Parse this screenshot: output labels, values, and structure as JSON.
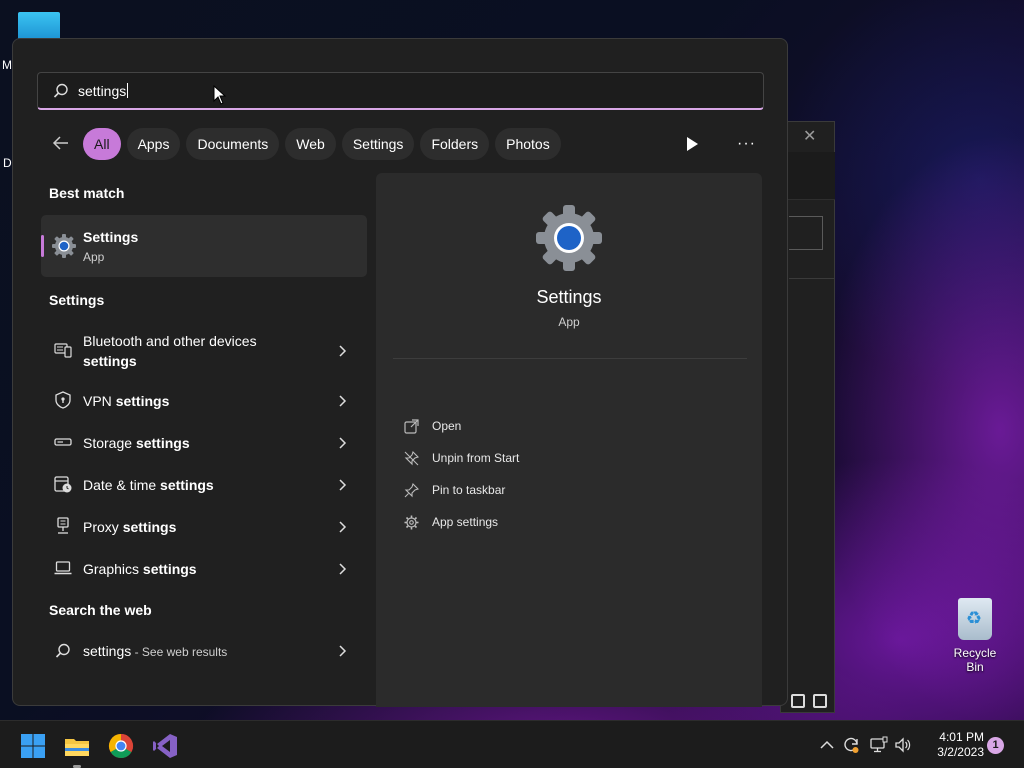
{
  "desktop": {
    "fragments": [
      "M",
      "D"
    ],
    "recycle_bin_label": "Recycle Bin"
  },
  "search": {
    "query": "settings"
  },
  "filters": {
    "chips": [
      "All",
      "Apps",
      "Documents",
      "Web",
      "Settings",
      "Folders",
      "Photos"
    ],
    "active": "All"
  },
  "left": {
    "best_match_heading": "Best match",
    "best_match": {
      "title": "Settings",
      "subtitle": "App"
    },
    "settings_heading": "Settings",
    "settings_items": [
      {
        "icon": "bluetooth-devices-icon",
        "line1": "Bluetooth and other devices",
        "line2": "settings"
      },
      {
        "icon": "vpn-shield-icon",
        "normal": "VPN",
        "bold": "settings"
      },
      {
        "icon": "storage-icon",
        "normal": "Storage",
        "bold": "settings"
      },
      {
        "icon": "date-time-icon",
        "normal": "Date & time",
        "bold": "settings"
      },
      {
        "icon": "proxy-icon",
        "normal": "Proxy",
        "bold": "settings"
      },
      {
        "icon": "graphics-laptop-icon",
        "normal": "Graphics",
        "bold": "settings"
      }
    ],
    "web_heading": "Search the web",
    "web_item": {
      "query": "settings",
      "suffix": " - See web results"
    }
  },
  "right": {
    "app_name": "Settings",
    "app_type": "App",
    "actions": [
      {
        "icon": "open-icon",
        "label": "Open"
      },
      {
        "icon": "unpin-icon",
        "label": "Unpin from Start"
      },
      {
        "icon": "pin-taskbar-icon",
        "label": "Pin to taskbar"
      },
      {
        "icon": "app-settings-gear-icon",
        "label": "App settings"
      }
    ]
  },
  "taskbar": {
    "apps": [
      "windows-start-icon",
      "file-explorer-icon",
      "chrome-icon",
      "visual-studio-icon"
    ],
    "time": "4:01 PM",
    "date": "3/2/2023",
    "notification_count": "1"
  },
  "colors": {
    "accent": "#c77ad9",
    "panel_bg": "#202020",
    "pane_bg": "#2b2b2b"
  }
}
